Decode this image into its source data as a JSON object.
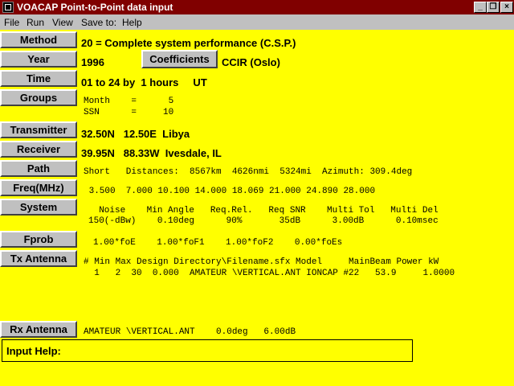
{
  "window": {
    "title": "VOACAP Point-to-Point data input",
    "controls": {
      "minimize": "_",
      "restore": "❐",
      "close": "×"
    }
  },
  "menu": [
    "File",
    "Run",
    "View",
    "Save to:",
    "Help"
  ],
  "sidebar": {
    "method": "Method",
    "year": "Year",
    "time": "Time",
    "groups": "Groups",
    "transmitter": "Transmitter",
    "receiver": "Receiver",
    "path": "Path",
    "freq": "Freq(MHz)",
    "system": "System",
    "fprob": "Fprob",
    "tx_antenna": "Tx Antenna",
    "rx_antenna": "Rx Antenna"
  },
  "method": {
    "text": "20 = Complete system performance (C.S.P.)"
  },
  "year": {
    "value": "1996",
    "coefficients_button": "Coefficients",
    "coefficients_label": "CCIR (Oslo)"
  },
  "time": {
    "text": "01 to 24 by  1 hours     UT"
  },
  "groups": {
    "month_line": "Month    =      5",
    "ssn_line": "SSN      =     10"
  },
  "transmitter": {
    "text": "32.50N   12.50E  Libya"
  },
  "receiver": {
    "text": "39.95N   88.33W  Ivesdale, IL"
  },
  "path": {
    "text": "Short   Distances:  8567km  4626nmi  5324mi  Azimuth: 309.4deg"
  },
  "freq": {
    "text": " 3.500  7.000 10.100 14.000 18.069 21.000 24.890 28.000"
  },
  "system": {
    "header": "  Noise    Min Angle   Req.Rel.   Req SNR    Multi Tol   Multi Del",
    "values": "150(-dBw)    0.10deg      90%       35dB      3.00dB      0.10msec"
  },
  "fprob": {
    "text": "1.00*foE    1.00*foF1    1.00*foF2    0.00*foEs"
  },
  "tx_antenna": {
    "header": "# Min Max Design Directory\\Filename.sfx Model     MainBeam Power kW",
    "row": "  1   2  30  0.000  AMATEUR \\VERTICAL.ANT IONCAP #22   53.9     1.0000"
  },
  "rx_antenna": {
    "text": "AMATEUR \\VERTICAL.ANT    0.0deg   6.00dB"
  },
  "input_help": {
    "label": "Input Help:"
  },
  "colors": {
    "titlebar": "#800000",
    "content_bg": "#ffff00",
    "button_face": "#c0c0c0"
  }
}
